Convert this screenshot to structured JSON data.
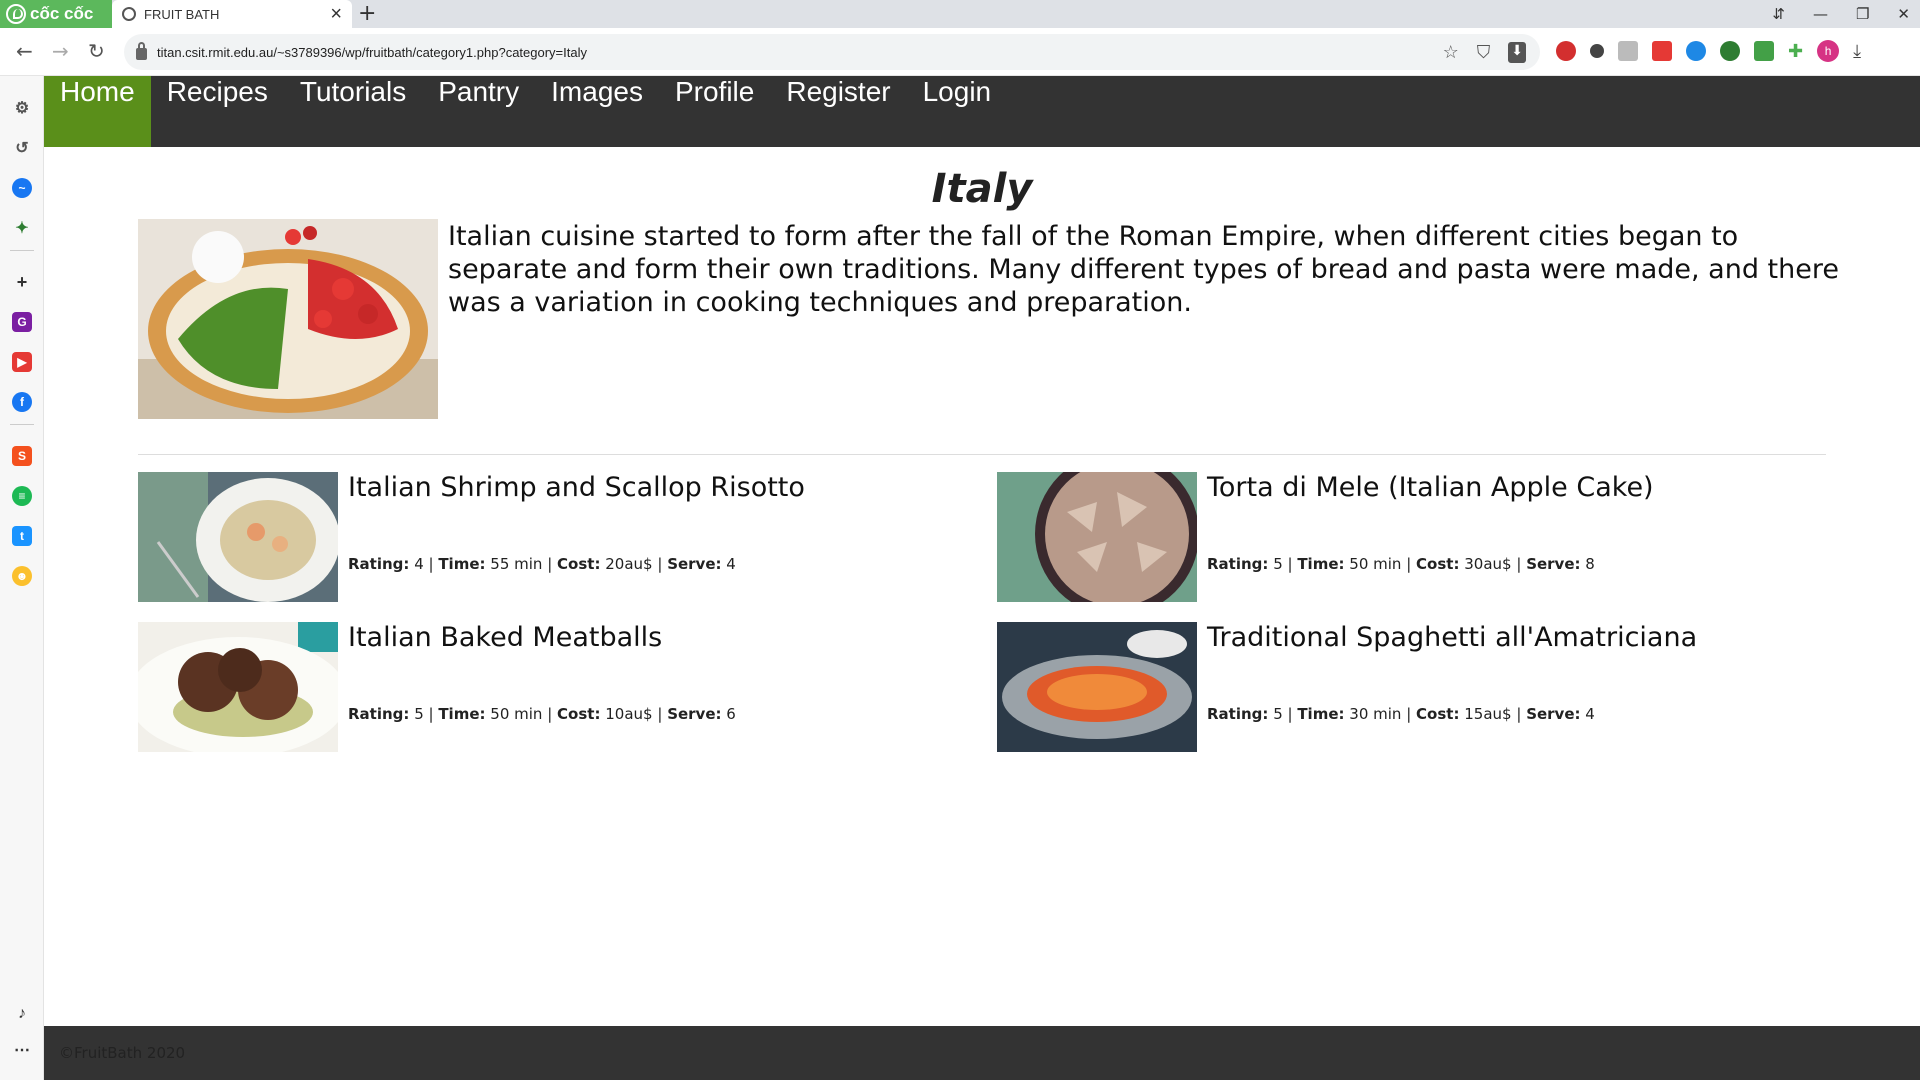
{
  "browser": {
    "brand": "cốc cốc",
    "tab_title": "FRUIT BATH",
    "url": "titan.csit.rmit.edu.au/~s3789396/wp/fruitbath/category1.php?category=Italy",
    "avatar_letter": "h"
  },
  "nav": {
    "home": "Home",
    "recipes": "Recipes",
    "tutorials": "Tutorials",
    "pantry": "Pantry",
    "images": "Images",
    "profile": "Profile",
    "register": "Register",
    "login": "Login"
  },
  "category": {
    "title": "Italy",
    "description": "Italian cuisine started to form after the fall of the Roman Empire, when different cities began to separate and form their own traditions. Many different types of bread and pasta were made, and there was a variation in cooking techniques and preparation."
  },
  "labels": {
    "rating": "Rating:",
    "time": "Time:",
    "cost": "Cost:",
    "serve": "Serve:"
  },
  "recipes": [
    {
      "title": "Italian Shrimp and Scallop Risotto",
      "rating": "4",
      "time": "55 min",
      "cost": "20au$",
      "serve": "4"
    },
    {
      "title": "Torta di Mele (Italian Apple Cake)",
      "rating": "5",
      "time": "50 min",
      "cost": "30au$",
      "serve": "8"
    },
    {
      "title": "Italian Baked Meatballs",
      "rating": "5",
      "time": "50 min",
      "cost": "10au$",
      "serve": "6"
    },
    {
      "title": "Traditional Spaghetti all'Amatriciana",
      "rating": "5",
      "time": "30 min",
      "cost": "15au$",
      "serve": "4"
    }
  ],
  "footer": {
    "copyright": "©FruitBath 2020"
  },
  "colors": {
    "nav_bg": "#333333",
    "nav_active": "#5a8f1a",
    "brand_green": "#5cb85c"
  }
}
